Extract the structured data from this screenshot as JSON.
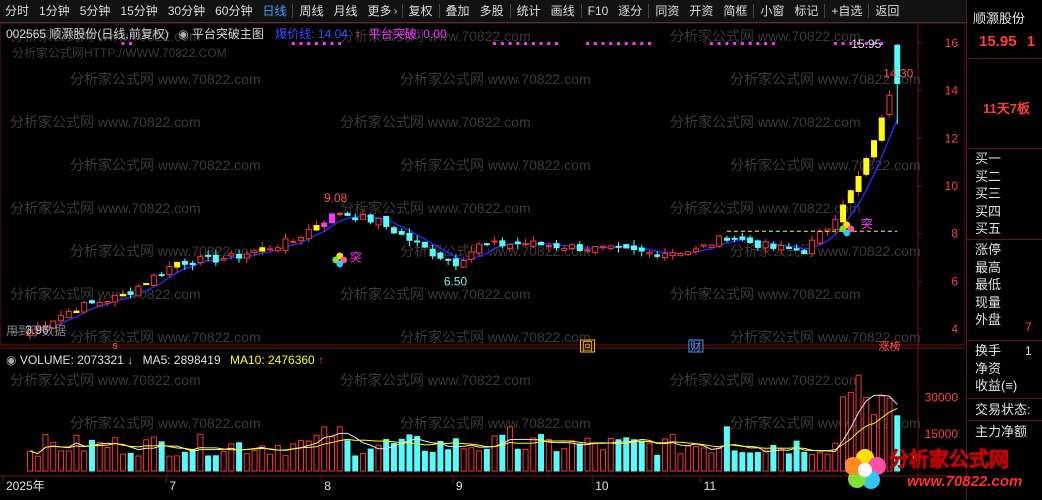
{
  "toolbar": {
    "items": [
      "分时",
      "1分钟",
      "5分钟",
      "15分钟",
      "30分钟",
      "60分钟",
      "日线",
      "周线",
      "月线",
      "更多",
      "复权",
      "叠加",
      "多股",
      "统计",
      "画线",
      "F10",
      "逐分",
      "同资",
      "开资",
      "简框",
      "小窗",
      "标记",
      "+自选",
      "返回"
    ],
    "active": "日线",
    "more_arrow": "›"
  },
  "chart_header": {
    "stock_title": "002565 顺灏股份(日线,前复权)",
    "formula": "平台突破主图",
    "indicator1_label": "爆价线: 14.04",
    "indicator2_label": "平台突破: 0.00",
    "arrow": "↑"
  },
  "volume_header": {
    "volume": "VOLUME: 2073321",
    "ma5": "MA5: 2898419",
    "ma10": "MA10: 2476360"
  },
  "watermark": {
    "line": "分析家公式网 www.70822.com",
    "url_line": "分析家公式网HTTP://WWW.70822.COM",
    "logo_cn": "分析家公式网",
    "logo_url": "www.70822.com"
  },
  "chart_annotations": {
    "high1": "9.08",
    "low1": "6.50",
    "start_low": "← 3.96",
    "peak_high": "15.95",
    "last_close": "14.30",
    "breakout": "突",
    "used_data": "用到了数据",
    "badge_hui": "回",
    "badge_cai": "财",
    "badge_zhangbang": "涨榜",
    "badge_s": "s"
  },
  "colors": {
    "up": "#ff3232",
    "down": "#54fcfc",
    "limit_up": "#ffff00",
    "ma_line": "#1e2cff",
    "platform": "#ffff00",
    "accent_blue": "#39a0ff",
    "magenta": "#ff33ff"
  },
  "chart_data": {
    "type": "candlestick",
    "ylim": [
      3.5,
      16.5
    ],
    "yticks": [
      4.0,
      6.0,
      8.0,
      10.0,
      12.0,
      14.0,
      16.0
    ],
    "xticks": [
      {
        "label": "2025年",
        "index": 0
      },
      {
        "label": "7",
        "index": 18
      },
      {
        "label": "8",
        "index": 38
      },
      {
        "label": "9",
        "index": 55
      },
      {
        "label": "10",
        "index": 73
      },
      {
        "label": "11",
        "index": 87
      }
    ],
    "volume_ticks": [
      15000,
      30000
    ],
    "peak_high": 15.95,
    "last_close": 14.3
  },
  "right_panel": {
    "stock_name": "顺灏股份",
    "price": "15.95",
    "price_suffix": "1",
    "streak": "11天7板",
    "bid_labels": [
      "买一",
      "买二",
      "买三",
      "买四",
      "买五"
    ],
    "stats_labels": [
      "涨停",
      "最高",
      "最低",
      "现量",
      "外盘"
    ],
    "outer_value": "7",
    "misc_labels": [
      "换手",
      "净资",
      "收益(≡)"
    ],
    "turnover_value": "1",
    "trade_status": "交易状态:",
    "main_net": "主力净额"
  }
}
